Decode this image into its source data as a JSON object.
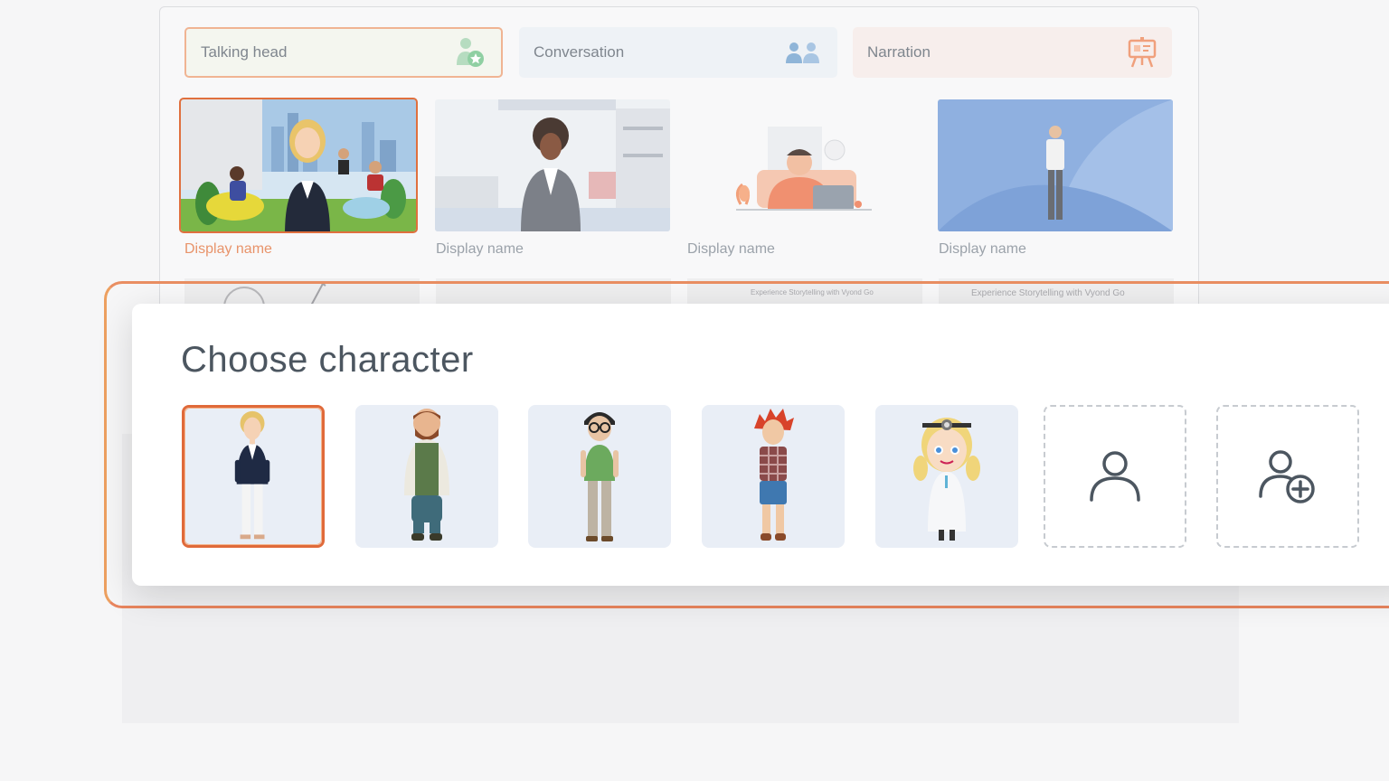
{
  "template_tabs": [
    {
      "label": "Talking head",
      "icon": "talking-head-icon",
      "selected": true
    },
    {
      "label": "Conversation",
      "icon": "conversation-icon",
      "selected": false
    },
    {
      "label": "Narration",
      "icon": "presentation-board-icon",
      "selected": false
    }
  ],
  "templates": [
    {
      "label": "Display name",
      "selected": true
    },
    {
      "label": "Display name",
      "selected": false
    },
    {
      "label": "Display name",
      "selected": false
    },
    {
      "label": "Display name",
      "selected": false
    }
  ],
  "second_row_captions": [
    "Experience Storytelling with Vyond Go",
    "Experience Storytelling with Vyond Go"
  ],
  "modal": {
    "title": "Choose character",
    "characters": [
      {
        "name": "blonde-businesswoman",
        "selected": true
      },
      {
        "name": "bearded-man-cardigan",
        "selected": false
      },
      {
        "name": "man-with-glasses",
        "selected": false
      },
      {
        "name": "red-haired-kid",
        "selected": false
      },
      {
        "name": "doctor-girl",
        "selected": false
      }
    ],
    "actions": [
      {
        "icon": "user-icon"
      },
      {
        "icon": "add-user-icon"
      }
    ]
  },
  "colors": {
    "accent": "#e0703e",
    "card_bg": "#e9eef6",
    "title": "#4c5660"
  }
}
